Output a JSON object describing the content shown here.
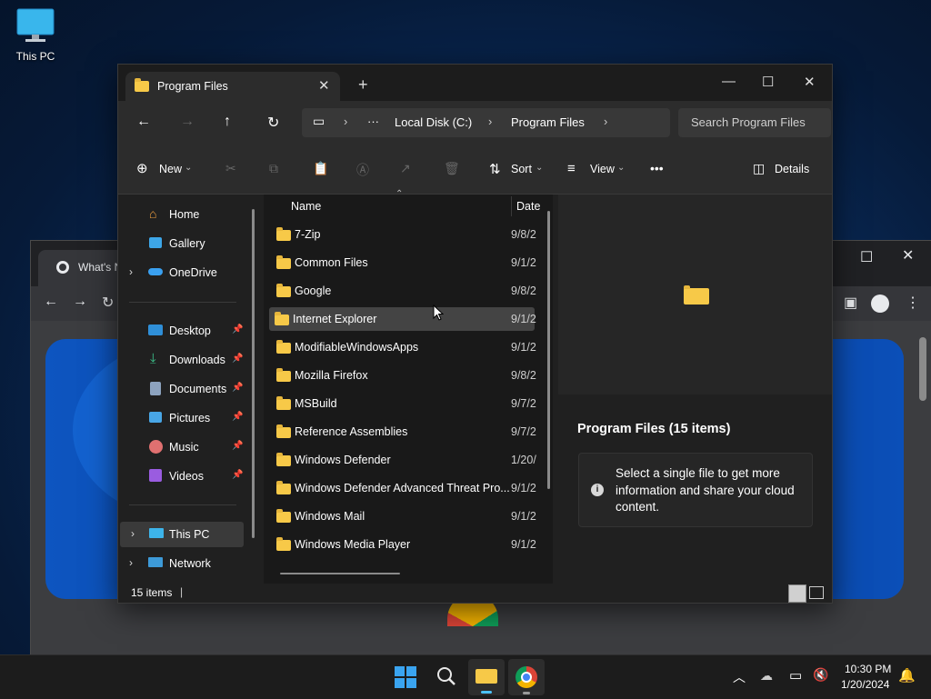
{
  "desktop": {
    "this_pc_label": "This PC"
  },
  "browser": {
    "tab_title": "What's Ne"
  },
  "explorer": {
    "tab_title": "Program Files",
    "new_tab": "+",
    "breadcrumb": {
      "ellipsis": "···",
      "drive": "Local Disk (C:)",
      "folder": "Program Files"
    },
    "search_placeholder": "Search Program Files",
    "toolbar": {
      "new_label": "New",
      "sort_label": "Sort",
      "view_label": "View",
      "more_label": "•••",
      "details_label": "Details"
    },
    "nav": {
      "home": "Home",
      "gallery": "Gallery",
      "onedrive": "OneDrive",
      "desktop": "Desktop",
      "downloads": "Downloads",
      "documents": "Documents",
      "pictures": "Pictures",
      "music": "Music",
      "videos": "Videos",
      "this_pc": "This PC",
      "network": "Network"
    },
    "columns": {
      "name": "Name",
      "date": "Date"
    },
    "files": [
      {
        "name": "7-Zip",
        "date": "9/8/2"
      },
      {
        "name": "Common Files",
        "date": "9/1/2"
      },
      {
        "name": "Google",
        "date": "9/8/2"
      },
      {
        "name": "Internet Explorer",
        "date": "9/1/2"
      },
      {
        "name": "ModifiableWindowsApps",
        "date": "9/1/2"
      },
      {
        "name": "Mozilla Firefox",
        "date": "9/8/2"
      },
      {
        "name": "MSBuild",
        "date": "9/7/2"
      },
      {
        "name": "Reference Assemblies",
        "date": "9/7/2"
      },
      {
        "name": "Windows Defender",
        "date": "1/20/"
      },
      {
        "name": "Windows Defender Advanced Threat Pro...",
        "date": "9/1/2"
      },
      {
        "name": "Windows Mail",
        "date": "9/1/2"
      },
      {
        "name": "Windows Media Player",
        "date": "9/1/2"
      }
    ],
    "details_pane": {
      "title": "Program Files (15 items)",
      "info": "Select a single file to get more information and share your cloud content."
    },
    "status": "15 items"
  },
  "taskbar": {
    "time": "10:30 PM",
    "date": "1/20/2024"
  },
  "colors": {
    "accent": "#4cc2ff",
    "folder": "#f7c948",
    "bg": "#202020"
  }
}
